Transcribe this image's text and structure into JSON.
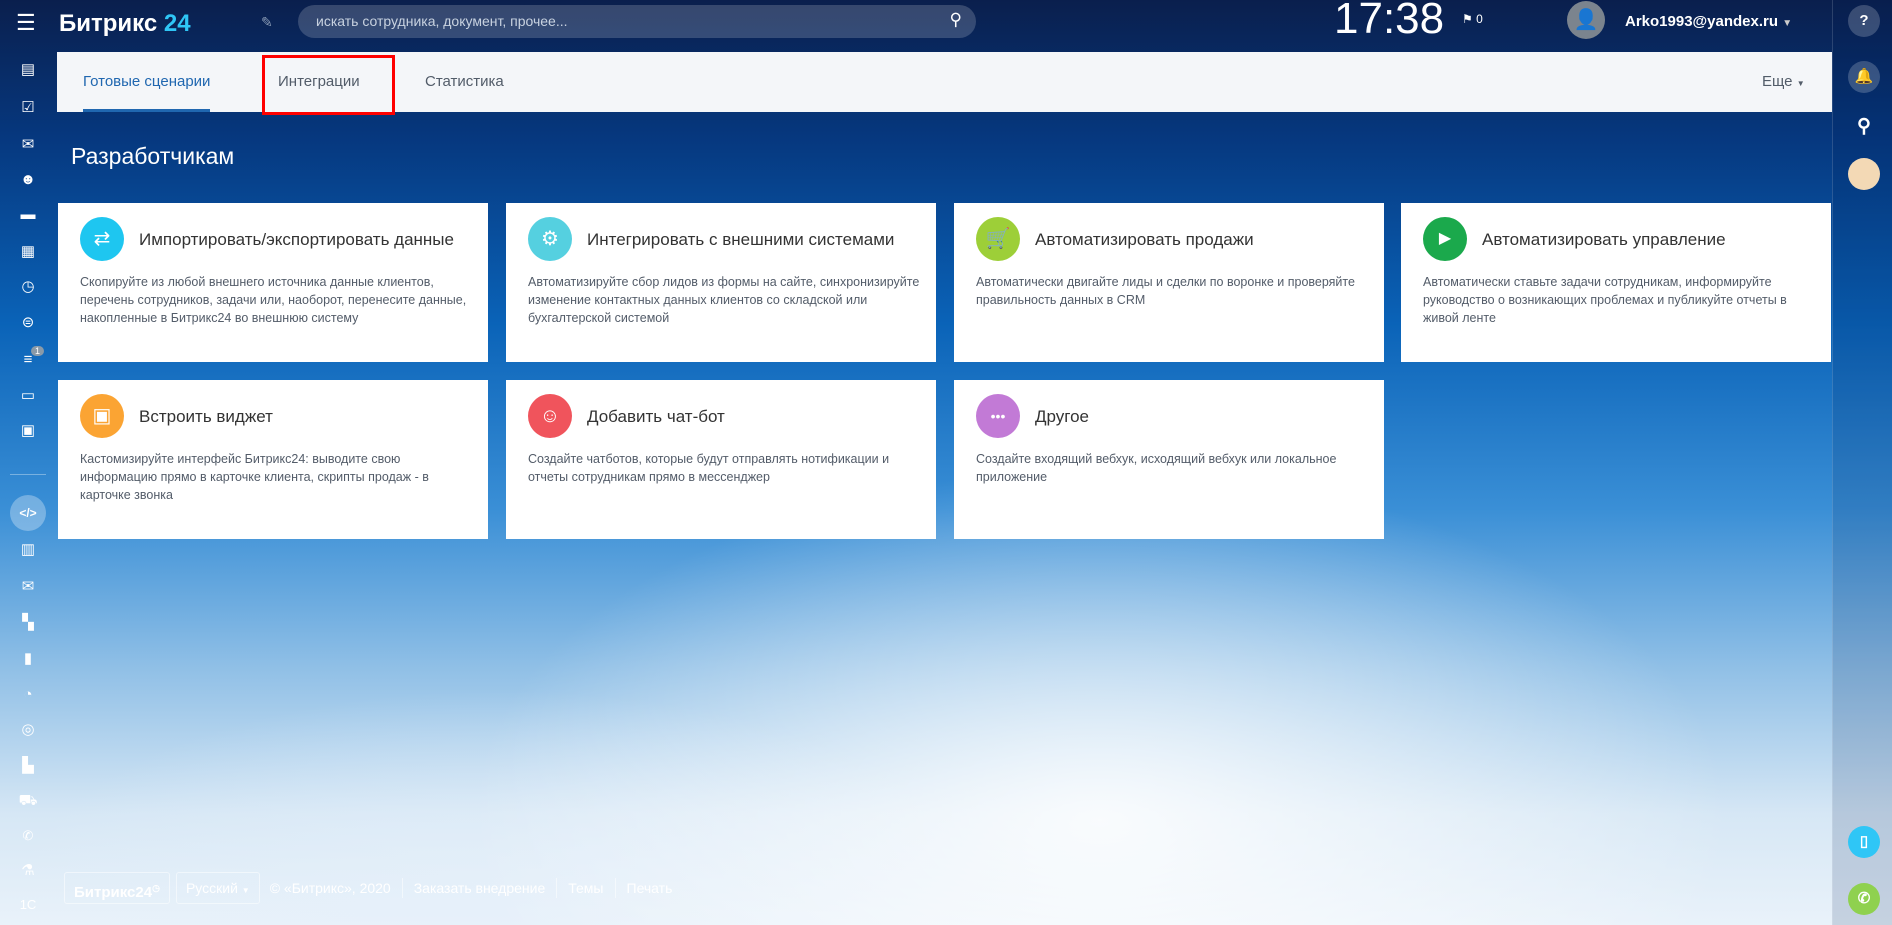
{
  "header": {
    "logo_text": "Битрикс",
    "logo_num": "24",
    "search_placeholder": "искать сотрудника, документ, прочее...",
    "clock": "17:38",
    "flag_count": "0",
    "user": "Arko1993@yandex.ru"
  },
  "tabs": [
    {
      "label": "Готовые сценарии",
      "active": true
    },
    {
      "label": "Интеграции",
      "highlighted": true
    },
    {
      "label": "Статистика"
    }
  ],
  "tabs_more": "Еще",
  "page_title": "Разработчикам",
  "sidebar": {
    "badge": "1",
    "icons": [
      "feed-icon",
      "tasks-icon",
      "chat-icon",
      "group-icon",
      "drive-icon",
      "calendar-icon",
      "clock-icon",
      "robot-icon",
      "filter-icon",
      "window-icon",
      "contact-card-icon",
      "developer-icon",
      "book-icon",
      "mail-icon",
      "apps-icon",
      "chart-icon",
      "timeman-icon",
      "target-icon",
      "cash-register-icon",
      "cart-icon",
      "phone-icon",
      "lab-icon",
      "1c-icon"
    ]
  },
  "cards": [
    {
      "title": "Импортировать/экспортировать данные",
      "desc": "Скопируйте из любой внешнего источника данные клиентов, перечень сотрудников, задачи или, наоборот, перенесите данные, накопленные в Битрикс24 во внешнюю систему",
      "color": "#1ec6f0",
      "icon": "exchange-icon"
    },
    {
      "title": "Интегрировать с внешними системами",
      "desc": "Автоматизируйте сбор лидов из формы на сайте, синхронизируйте изменение контактных данных клиентов со складской или бухгалтерской системой",
      "color": "#55d0e0",
      "icon": "gears-icon"
    },
    {
      "title": "Автоматизировать продажи",
      "desc": "Автоматически двигайте лиды и сделки по воронке и проверяйте правильность данных в CRM",
      "color": "#9dcf38",
      "icon": "cart-icon"
    },
    {
      "title": "Автоматизировать управление",
      "desc": "Автоматически ставьте задачи сотрудникам, информируйте руководство о возникающих проблемах и публикуйте отчеты в живой ленте",
      "color": "#1ba94c",
      "icon": "play-icon"
    },
    {
      "title": "Встроить виджет",
      "desc": "Кастомизируйте интерфейс Битрикс24: выводите свою информацию прямо в карточке клиента, скрипты продаж - в карточке звонка",
      "color": "#fba433",
      "icon": "widget-icon"
    },
    {
      "title": "Добавить чат-бот",
      "desc": "Создайте чатботов, которые будут отправлять нотификации и отчеты сотрудникам прямо в мессенджер",
      "color": "#f0545c",
      "icon": "bot-icon"
    },
    {
      "title": "Другое",
      "desc": "Создайте входящий вебхук, исходящий вебхук или локальное приложение",
      "color": "#c27ad6",
      "icon": "more-icon"
    }
  ],
  "footer": {
    "logo": "Битрикс24",
    "language": "Русский",
    "copyright": "© «Битрикс», 2020",
    "links": [
      "Заказать внедрение",
      "Темы",
      "Печать"
    ]
  }
}
